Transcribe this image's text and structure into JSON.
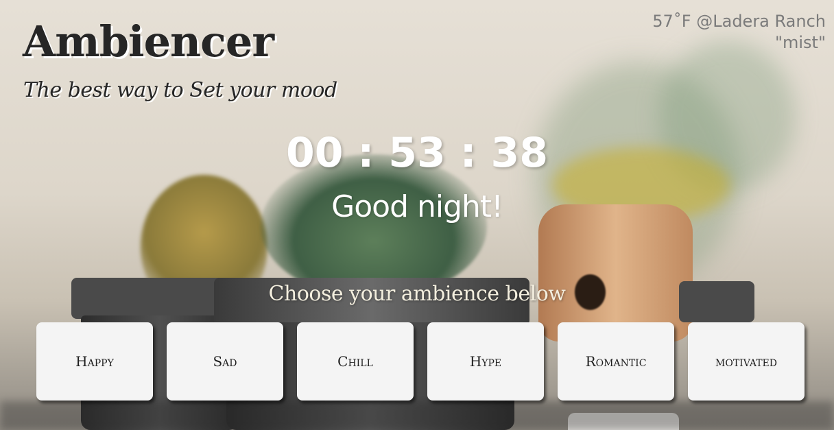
{
  "header": {
    "title": "Ambiencer",
    "tagline": "The best way to Set your mood"
  },
  "weather": {
    "line1": "57˚F @Ladera Ranch",
    "line2": "\"mist\""
  },
  "clock": {
    "time": "00 : 53 : 38",
    "greeting": "Good night!"
  },
  "ambience": {
    "prompt": "Choose your ambience below",
    "options": [
      "Happy",
      "Sad",
      "Chill",
      "Hype",
      "Romantic",
      "motivated"
    ]
  },
  "colors": {
    "title_text": "#262626",
    "button_bg": "#f4f4f4",
    "weather_text": "#7b7b7b",
    "clock_text": "#ffffff"
  }
}
